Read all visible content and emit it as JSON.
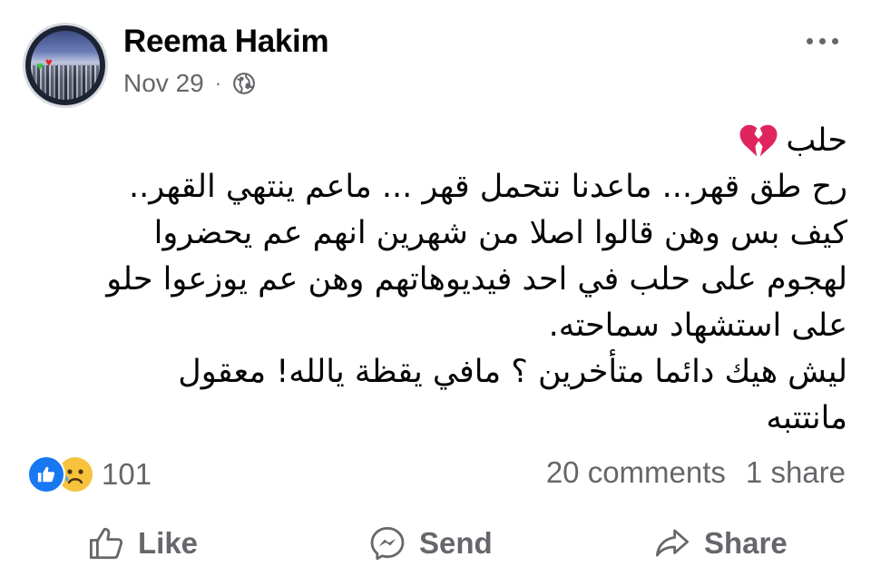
{
  "header": {
    "author_name": "Reema Hakim",
    "date": "Nov 29",
    "separator": "·"
  },
  "post": {
    "lines": [
      "حلب",
      "رح طق قهر... ماعدنا نتحمل قهر ... ماعم ينتهي القهر..",
      "كيف بس وهن قالوا اصلا من شهرين انهم عم يحضروا",
      "لهجوم على حلب في احد فيديوهاتهم وهن عم يوزعوا حلو",
      "على استشهاد سماحته.",
      "ليش هيك دائما  متأخرين ؟ مافي يقظة يالله!  معقول",
      "مانتتبه"
    ]
  },
  "reactions": {
    "count": "101",
    "icons": [
      "like-icon",
      "sad-face-icon"
    ]
  },
  "stats": {
    "comments": "20 comments",
    "shares": "1 share"
  },
  "actions": {
    "like_label": "Like",
    "send_label": "Send",
    "share_label": "Share"
  },
  "colors": {
    "text": "#050505",
    "secondary": "#65676b",
    "like_blue": "#1877f2",
    "sad_yellow": "#f7c33c",
    "broken_heart": "#e0245e"
  }
}
